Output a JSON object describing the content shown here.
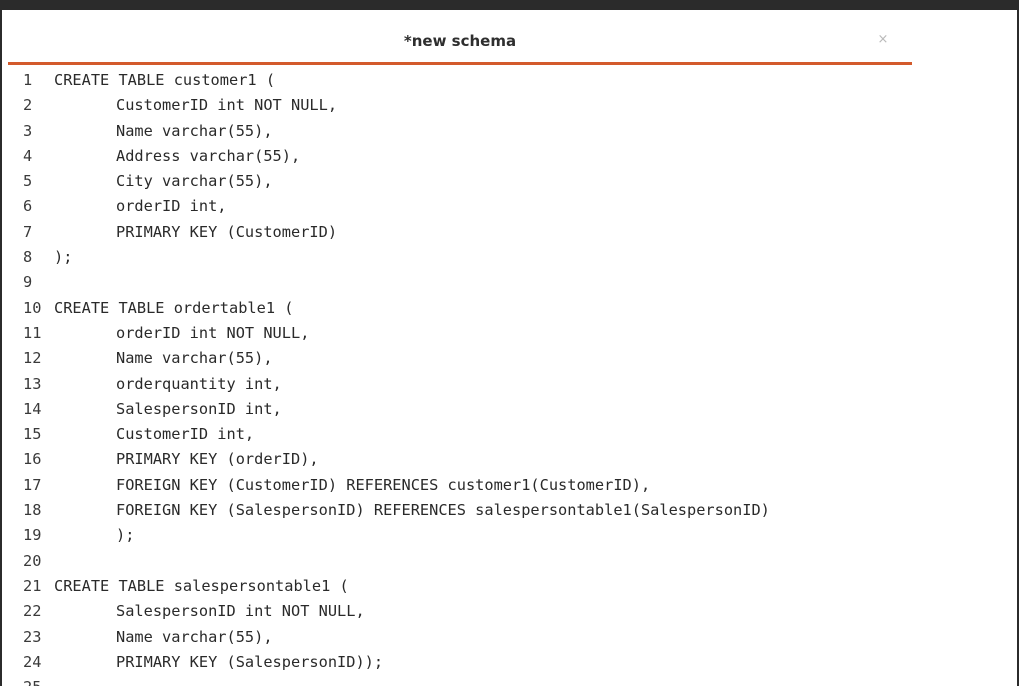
{
  "tab": {
    "title": "*new schema",
    "close_icon": "×"
  },
  "lines": [
    {
      "n": "1",
      "text": "CREATE TABLE customer1 ("
    },
    {
      "n": "2",
      "text": "CustomerID int NOT NULL,"
    },
    {
      "n": "3",
      "text": "Name varchar(55),"
    },
    {
      "n": "4",
      "text": "Address varchar(55),"
    },
    {
      "n": "5",
      "text": "City varchar(55),"
    },
    {
      "n": "6",
      "text": "orderID int,"
    },
    {
      "n": "7",
      "text": "PRIMARY KEY (CustomerID)"
    },
    {
      "n": "8",
      "text": ");"
    },
    {
      "n": "9",
      "text": ""
    },
    {
      "n": "10",
      "text": "CREATE TABLE ordertable1 ("
    },
    {
      "n": "11",
      "text": "orderID int NOT NULL,"
    },
    {
      "n": "12",
      "text": "Name varchar(55),"
    },
    {
      "n": "13",
      "text": "orderquantity int,"
    },
    {
      "n": "14",
      "text": "SalespersonID int,"
    },
    {
      "n": "15",
      "text": "CustomerID int,"
    },
    {
      "n": "16",
      "text": "PRIMARY KEY (orderID),"
    },
    {
      "n": "17",
      "text": "FOREIGN KEY (CustomerID) REFERENCES customer1(CustomerID),"
    },
    {
      "n": "18",
      "text": "FOREIGN KEY (SalespersonID) REFERENCES salespersontable1(SalespersonID)"
    },
    {
      "n": "19",
      "text": ");"
    },
    {
      "n": "20",
      "text": ""
    },
    {
      "n": "21",
      "text": "CREATE TABLE salespersontable1 ("
    },
    {
      "n": "22",
      "text": "SalespersonID int NOT NULL,"
    },
    {
      "n": "23",
      "text": "Name varchar(55),"
    },
    {
      "n": "24",
      "text": "PRIMARY KEY (SalespersonID));"
    },
    {
      "n": "25",
      "text": ""
    }
  ],
  "colors": {
    "accent_underline": "#d35a2c",
    "frame": "#2b2b2b",
    "text": "#2a2a2a"
  }
}
